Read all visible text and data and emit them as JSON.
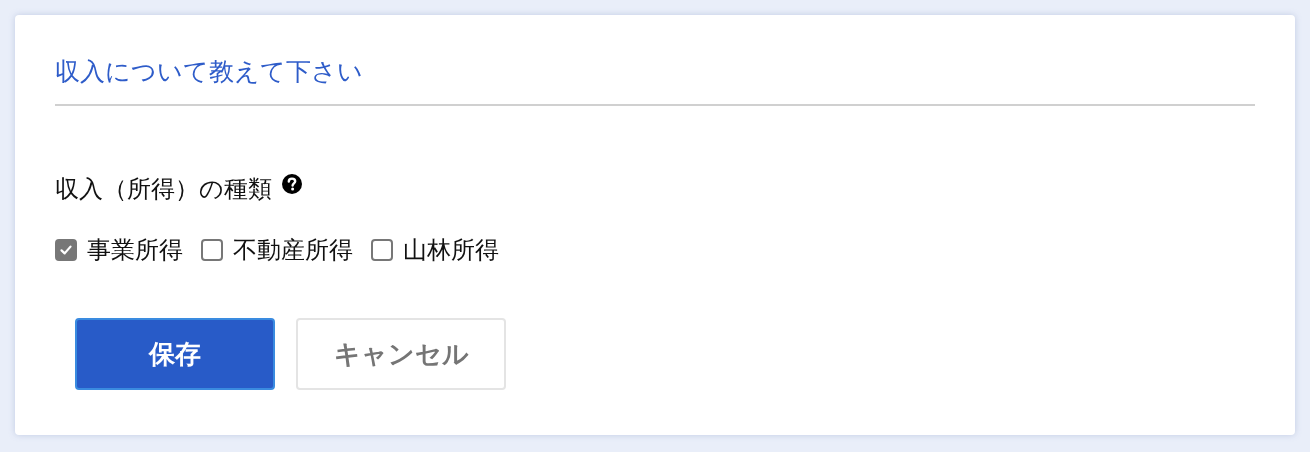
{
  "form": {
    "title": "収入について教えて下さい",
    "field": {
      "label": "収入（所得）の種類",
      "help": true,
      "options": [
        {
          "label": "事業所得",
          "checked": true
        },
        {
          "label": "不動産所得",
          "checked": false
        },
        {
          "label": "山林所得",
          "checked": false
        }
      ]
    },
    "buttons": [
      {
        "label": "保存",
        "kind": "primary"
      },
      {
        "label": "キャンセル",
        "kind": "secondary"
      }
    ]
  }
}
